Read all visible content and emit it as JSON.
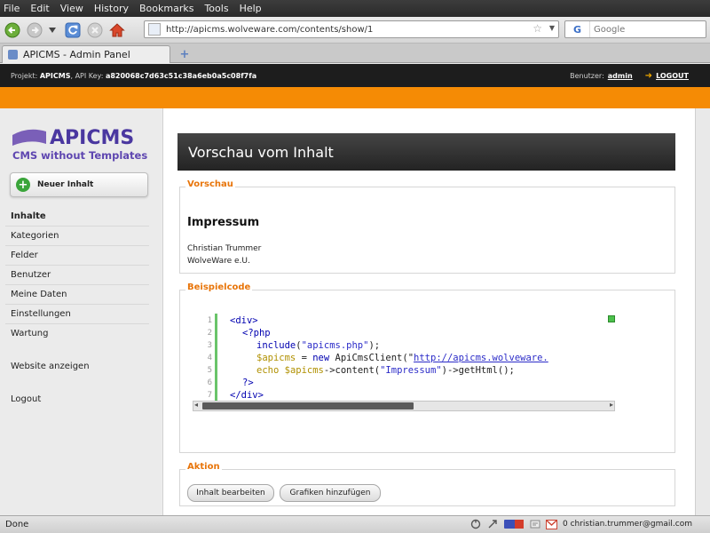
{
  "menu": [
    "File",
    "Edit",
    "View",
    "History",
    "Bookmarks",
    "Tools",
    "Help"
  ],
  "browser": {
    "url": "http://apicms.wolveware.com/contents/show/1",
    "search_placeholder": "Google",
    "search_engine": "G",
    "tab_title": "APICMS - Admin Panel",
    "newtab_glyph": "+"
  },
  "header": {
    "projekt_label": "Projekt:",
    "projekt": "APICMS",
    "apikey_label": "API Key:",
    "apikey": "a820068c7d63c51c38a6eb0a5c08f7fa",
    "benutzer_label": "Benutzer:",
    "user": "admin",
    "logout": "LOGOUT"
  },
  "logo": {
    "title": "APICMS",
    "subtitle": "CMS without Templates"
  },
  "sidebar": {
    "new_button": "Neuer Inhalt",
    "items": [
      "Inhalte",
      "Kategorien",
      "Felder",
      "Benutzer",
      "Meine Daten",
      "Einstellungen",
      "Wartung"
    ],
    "website": "Website anzeigen",
    "logout": "Logout"
  },
  "main": {
    "title": "Vorschau vom Inhalt",
    "preview_legend": "Vorschau",
    "content_title": "Impressum",
    "address_line1": "Christian Trummer",
    "address_line2": "WolveWare e.U.",
    "code_legend": "Beispielcode",
    "code_lines": {
      "l1": "<div>",
      "l2": "<?php",
      "l3_fn": "include",
      "l3_arg": "\"apicms.php\"",
      "l3_end": ");",
      "l4_var": "$apicms",
      "l4_mid": " = ",
      "l4_new": "new",
      "l4_cls": " ApiCmsClient(\"",
      "l4_url": "http://apicms.wolveware.",
      "l5_kw": "echo",
      "l5_var": "$apicms",
      "l5_mid": "->content(",
      "l5_arg": "\"Impressum\"",
      "l5_end": ")->getHtml();",
      "l6": "?>",
      "l7": "</div>"
    },
    "line_numbers": [
      "1",
      "2",
      "3",
      "4",
      "5",
      "6",
      "7"
    ],
    "action_legend": "Aktion",
    "edit_button": "Inhalt bearbeiten",
    "graphics_button": "Grafiken hinzufügen"
  },
  "status": {
    "text": "Done",
    "mail_count": "0",
    "email": "christian.trummer@gmail.com"
  },
  "colors": {
    "accent": "#f58b05",
    "legend": "#e8750a",
    "dark": "#1d1d1d"
  }
}
